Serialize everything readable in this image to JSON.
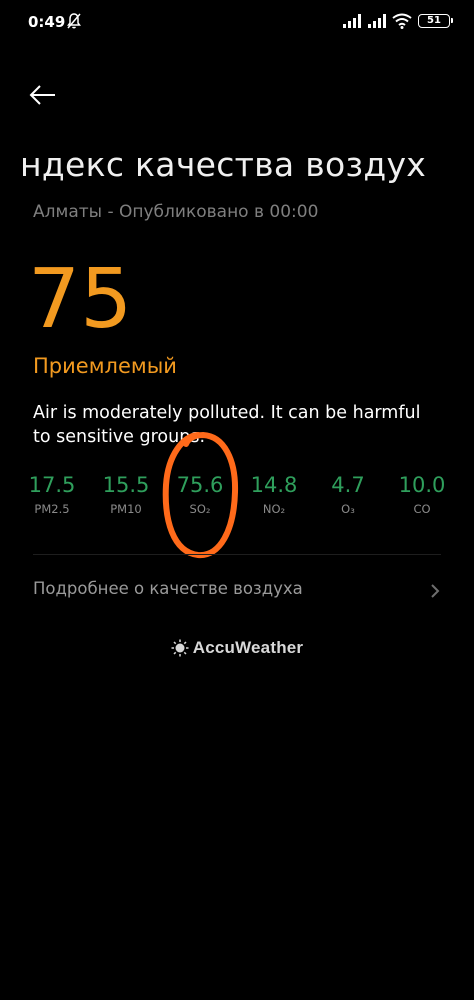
{
  "status_bar": {
    "time": "0:49",
    "battery": "51"
  },
  "header": {
    "title": "ндекс качества воздух",
    "subtitle": "Алматы - Опубликовано в 00:00"
  },
  "aqi": {
    "value": "75",
    "category": "Приемлемый",
    "description": "Air is moderately polluted. It can be harmful to sensitive groups.",
    "accent_color": "#f29a20"
  },
  "pollutants": [
    {
      "value": "17.5",
      "label": "PM2.5"
    },
    {
      "value": "15.5",
      "label": "PM10"
    },
    {
      "value": "75.6",
      "label": "SO₂"
    },
    {
      "value": "14.8",
      "label": "NO₂"
    },
    {
      "value": "4.7",
      "label": "O₃"
    },
    {
      "value": "10.0",
      "label": "CO"
    }
  ],
  "pollutant_color": "#2f9f5c",
  "more_link": {
    "label": "Подробнее о качестве воздуха"
  },
  "brand": {
    "label": "AccuWeather"
  }
}
